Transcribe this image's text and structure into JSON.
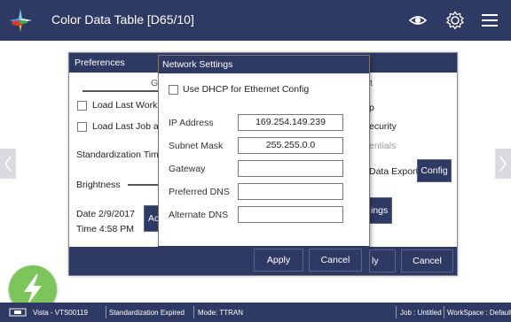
{
  "title_bar": {
    "title": "Color Data Table [D65/10]",
    "icons": [
      "app-logo",
      "eye-icon",
      "gear-icon",
      "menu-icon"
    ]
  },
  "preferences": {
    "title": "Preferences",
    "tab_left": "Ge",
    "tab_right": "t",
    "load_last_workspace": "Load Last Works",
    "load_last_job": "Load Last Job a",
    "standardization_time": "Standardization Tim",
    "brightness": "Brightness",
    "date": "Date  2/9/2017",
    "time": "Time  4:58 PM",
    "adjust_button": "Ac",
    "right_p": "p",
    "security": "ecurity",
    "credentials": "entials",
    "data_export": "Data Export",
    "config_button": "Config",
    "settings_button": "ings",
    "apply_button": "ly",
    "cancel_button": "Cancel"
  },
  "network": {
    "title": "Network Settings",
    "dhcp_label": "Use DHCP for Ethernet Config",
    "dhcp_checked": false,
    "fields": [
      {
        "label": "IP Address",
        "value": "169.254.149.239"
      },
      {
        "label": "Subnet Mask",
        "value": "255.255.0.0"
      },
      {
        "label": "Gateway",
        "value": ""
      },
      {
        "label": "Preferred DNS",
        "value": ""
      },
      {
        "label": "Alternate DNS",
        "value": ""
      }
    ],
    "apply_button": "Apply",
    "cancel_button": "Cancel"
  },
  "status_bar": {
    "device": "Vista - VTS00119",
    "standardization": "Standardization Expired",
    "mode": "Mode: TTRAN",
    "job": "Job : Untitled",
    "workspace": "WorkSpace : Default"
  },
  "colors": {
    "header": "#2f3a64",
    "fab": "#7cc55a"
  }
}
